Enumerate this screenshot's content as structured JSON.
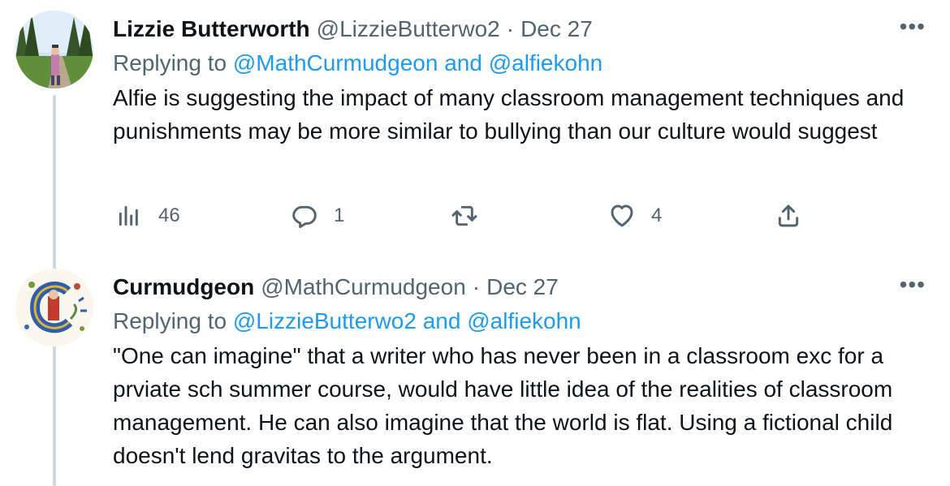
{
  "tweets": [
    {
      "name": "Lizzie Butterworth",
      "handle": "@LizzieButterwo2",
      "separator": "·",
      "date": "Dec 27",
      "more": "•••",
      "replying_prefix": "Replying to ",
      "mention1": "@MathCurmudgeon",
      "and": " and ",
      "mention2": "@alfiekohn",
      "text": "Alfie is suggesting the impact of many classroom management techniques and punishments may be more similar to bullying than our culture would suggest",
      "stats": {
        "views": "46",
        "replies": "1",
        "retweets": "",
        "likes": "4"
      }
    },
    {
      "name": "Curmudgeon",
      "handle": "@MathCurmudgeon",
      "separator": "·",
      "date": "Dec 27",
      "more": "•••",
      "replying_prefix": "Replying to ",
      "mention1": "@LizzieButterwo2",
      "and": " and ",
      "mention2": "@alfiekohn",
      "text": "\"One can imagine\" that a writer who has never been in a classroom exc for a prviate sch summer course, would have little idea of the realities of classroom management. He can also imagine that the world is flat. Using a fictional child doesn't lend gravitas to the argument."
    }
  ],
  "colors": {
    "link": "#1d9bf0",
    "muted": "#536471",
    "text": "#0f1419",
    "thread_line": "#cfd9de"
  },
  "icons": [
    "views-icon",
    "reply-icon",
    "retweet-icon",
    "like-icon",
    "share-icon"
  ]
}
